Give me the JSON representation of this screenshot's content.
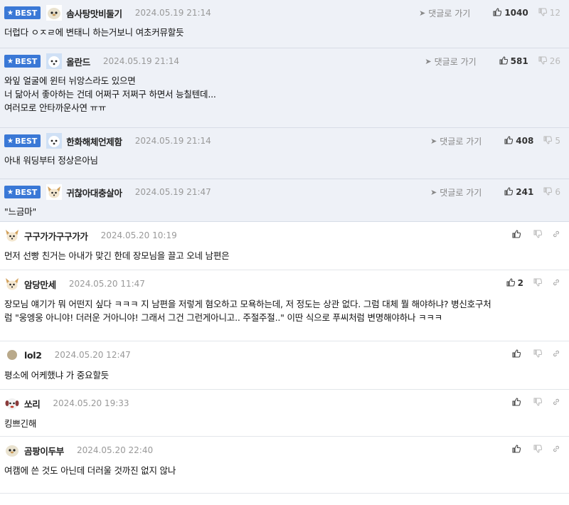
{
  "best_label": "BEST",
  "goto_label": "댓글로 가기",
  "best_comments": [
    {
      "nick": "솜사탕맛비둘기",
      "date": "2024.05.19 21:14",
      "up": "1040",
      "down": "12",
      "text": "더럽다 ㅇㅈㄹ에 변태니 하는거보니 여초커뮤할듯",
      "avatar": "bird"
    },
    {
      "nick": "올란드",
      "date": "2024.05.19 21:14",
      "up": "581",
      "down": "26",
      "text": "와잎 얼굴에 윈터 뉘앙스라도 있으면\n너 닮아서 좋아하는 건데 어쩌구 저쩌구 하면서 능칠텐데...\n여러모로 안타까운사연 ㅠㅠ",
      "avatar": "dog-white"
    },
    {
      "nick": "한화해체언제함",
      "date": "2024.05.19 21:14",
      "up": "408",
      "down": "5",
      "text": "아내 워딩부터 정상은아님",
      "avatar": "dog-white"
    },
    {
      "nick": "귀찮아대충살아",
      "date": "2024.05.19 21:47",
      "up": "241",
      "down": "6",
      "text": "\"느금마\"",
      "avatar": "fox"
    }
  ],
  "comments": [
    {
      "nick": "구구가가구구가가",
      "date": "2024.05.20 10:19",
      "up": "",
      "text": "먼저 선빵 친거는 아내가 맞긴 한데 장모님을 끌고 오네 남편은",
      "avatar": "fox"
    },
    {
      "nick": "암당만세",
      "date": "2024.05.20 11:47",
      "up": "2",
      "text": "장모님 얘기가 뭐 어떤지 싶다 ㅋㅋㅋ 지 남편을 저렇게 혐오하고 모욕하는데, 저 정도는 상관 없다. 그럼 대체 뭘 해야하냐? 병신호구처\n럼 \"웅엥웅 아니야! 더러운 거아니야! 그래서 그건 그런게아니고.. 주절주절..\" 이딴 식으로 푸씨처럼 변명해야하나 ㅋㅋㅋ",
      "avatar": "fox"
    },
    {
      "nick": "lol2",
      "date": "2024.05.20 12:47",
      "up": "",
      "text": "평소에 어케했냐 가 중요할듯",
      "avatar": "dot"
    },
    {
      "nick": "쏘리",
      "date": "2024.05.20 19:33",
      "up": "",
      "text": "킹쁘긴해",
      "avatar": "puppy"
    },
    {
      "nick": "곰팡이두부",
      "date": "2024.05.20 22:40",
      "up": "",
      "text": "여캠에 쓴 것도 아닌데 더러울 것까진 없지 않나",
      "avatar": "bird"
    }
  ]
}
